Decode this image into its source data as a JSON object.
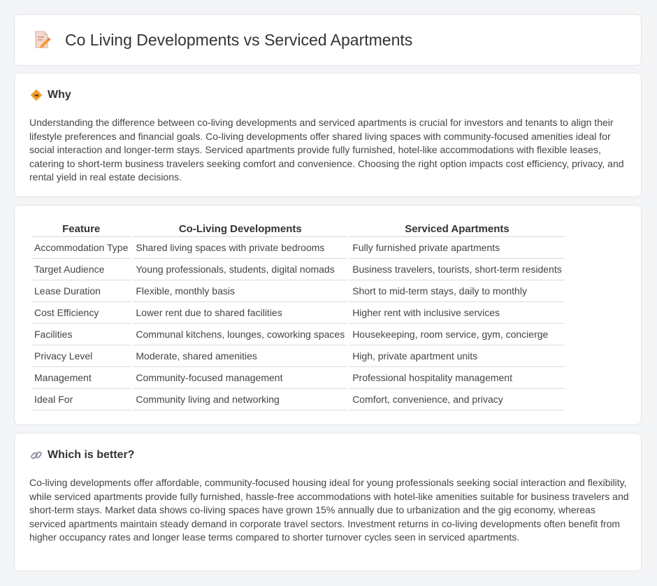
{
  "header": {
    "title": "Co Living Developments vs Serviced Apartments",
    "icon": "document-pencil-icon"
  },
  "why": {
    "heading": "Why",
    "icon": "diamond-signal-icon",
    "text": "Understanding the difference between co-living developments and serviced apartments is crucial for investors and tenants to align their lifestyle preferences and financial goals. Co-living developments offer shared living spaces with community-focused amenities ideal for social interaction and longer-term stays. Serviced apartments provide fully furnished, hotel-like accommodations with flexible leases, catering to short-term business travelers seeking comfort and convenience. Choosing the right option impacts cost efficiency, privacy, and rental yield in real estate decisions."
  },
  "table": {
    "headers": [
      "Feature",
      "Co-Living Developments",
      "Serviced Apartments"
    ],
    "rows": [
      [
        "Accommodation Type",
        "Shared living spaces with private bedrooms",
        "Fully furnished private apartments"
      ],
      [
        "Target Audience",
        "Young professionals, students, digital nomads",
        "Business travelers, tourists, short-term residents"
      ],
      [
        "Lease Duration",
        "Flexible, monthly basis",
        "Short to mid-term stays, daily to monthly"
      ],
      [
        "Cost Efficiency",
        "Lower rent due to shared facilities",
        "Higher rent with inclusive services"
      ],
      [
        "Facilities",
        "Communal kitchens, lounges, coworking spaces",
        "Housekeeping, room service, gym, concierge"
      ],
      [
        "Privacy Level",
        "Moderate, shared amenities",
        "High, private apartment units"
      ],
      [
        "Management",
        "Community-focused management",
        "Professional hospitality management"
      ],
      [
        "Ideal For",
        "Community living and networking",
        "Comfort, convenience, and privacy"
      ]
    ]
  },
  "better": {
    "heading": "Which is better?",
    "icon": "link-icon",
    "text": "Co-living developments offer affordable, community-focused housing ideal for young professionals seeking social interaction and flexibility, while serviced apartments provide fully furnished, hassle-free accommodations with hotel-like amenities suitable for business travelers and short-term stays. Market data shows co-living spaces have grown 15% annually due to urbanization and the gig economy, whereas serviced apartments maintain steady demand in corporate travel sectors. Investment returns in co-living developments often benefit from higher occupancy rates and longer lease terms compared to shorter turnover cycles seen in serviced apartments."
  },
  "colors": {
    "background": "#f4f5f7",
    "card": "#ffffff",
    "icon_orange": "#f0a030",
    "icon_pink": "#e66a6a"
  }
}
